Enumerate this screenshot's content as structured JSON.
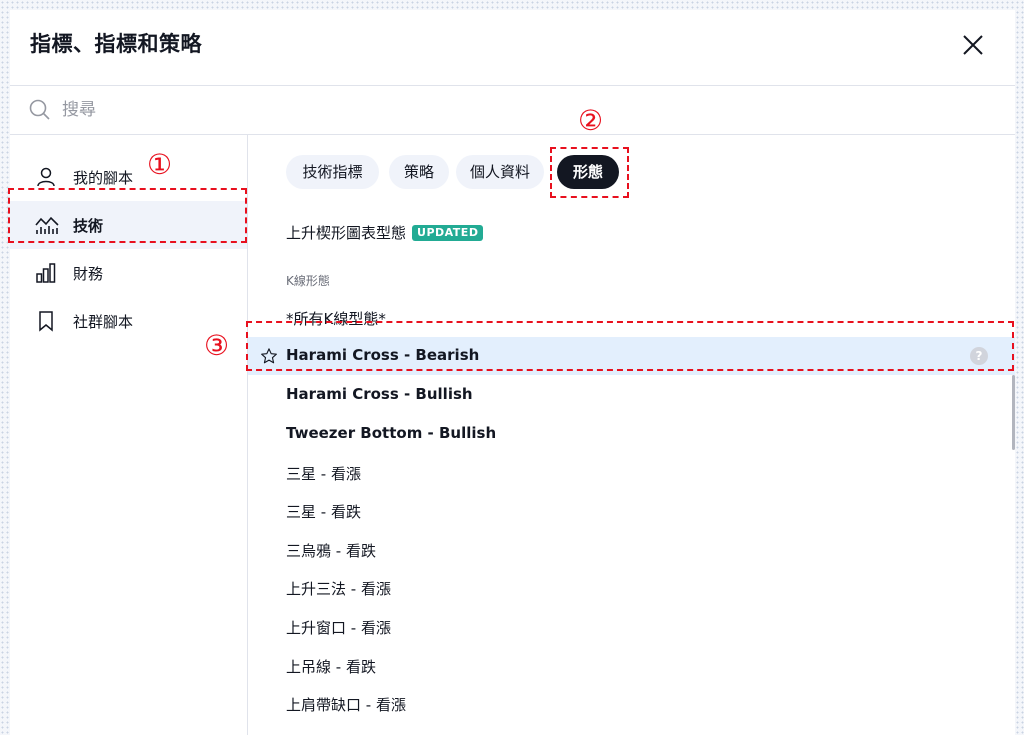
{
  "dialog": {
    "title": "指標、指標和策略",
    "close_icon": "close-icon"
  },
  "search": {
    "placeholder": "搜尋",
    "value": ""
  },
  "sidebar": {
    "items": [
      {
        "label": "我的腳本",
        "icon": "person-icon"
      },
      {
        "label": "技術",
        "icon": "chart-wave-icon",
        "active": true
      },
      {
        "label": "財務",
        "icon": "bar-chart-icon"
      },
      {
        "label": "社群腳本",
        "icon": "bookmark-icon"
      }
    ]
  },
  "tabs": [
    {
      "label": "技術指標"
    },
    {
      "label": "策略"
    },
    {
      "label": "個人資料"
    },
    {
      "label": "形態",
      "active": true
    }
  ],
  "list": {
    "top_item": {
      "label": "上升楔形圖表型態",
      "badge": "UPDATED"
    },
    "section_label": "K線形態",
    "items": [
      {
        "label": "*所有K線型態*"
      },
      {
        "label": "Harami Cross - Bearish",
        "highlighted": true
      },
      {
        "label": "Harami Cross - Bullish"
      },
      {
        "label": "Tweezer Bottom - Bullish"
      },
      {
        "label": "三星 - 看漲"
      },
      {
        "label": "三星 - 看跌"
      },
      {
        "label": "三烏鴉 - 看跌"
      },
      {
        "label": "上升三法 - 看漲"
      },
      {
        "label": "上升窗口 - 看漲"
      },
      {
        "label": "上吊線 - 看跌"
      },
      {
        "label": "上肩帶缺口 - 看漲"
      }
    ],
    "help_glyph": "?"
  },
  "annotations": {
    "marker_1": "①",
    "marker_2": "②",
    "marker_3": "③",
    "color": "#e8101e"
  },
  "colors": {
    "active_tab_bg": "#131722",
    "highlight_row_bg": "#e3effd",
    "badge_bg": "#22ab94"
  }
}
